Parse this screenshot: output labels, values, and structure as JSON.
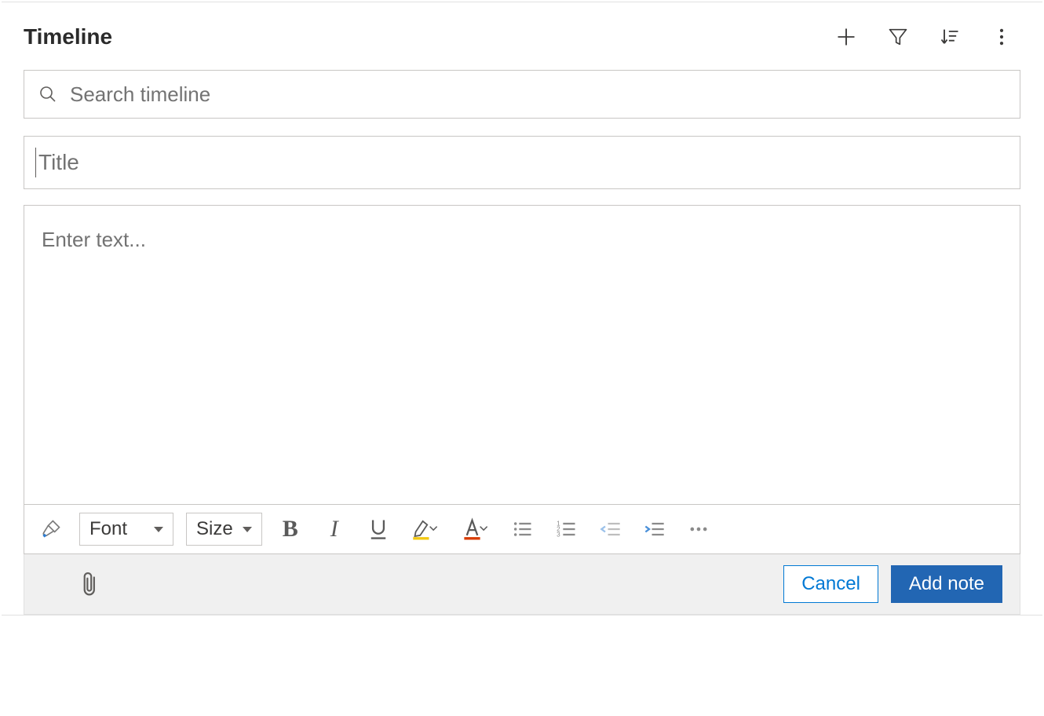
{
  "header": {
    "title": "Timeline"
  },
  "search": {
    "placeholder": "Search timeline",
    "value": ""
  },
  "note": {
    "title_placeholder": "Title",
    "title_value": "",
    "body_placeholder": "Enter text...",
    "body_value": ""
  },
  "toolbar": {
    "font_label": "Font",
    "size_label": "Size"
  },
  "footer": {
    "cancel_label": "Cancel",
    "add_note_label": "Add note"
  }
}
